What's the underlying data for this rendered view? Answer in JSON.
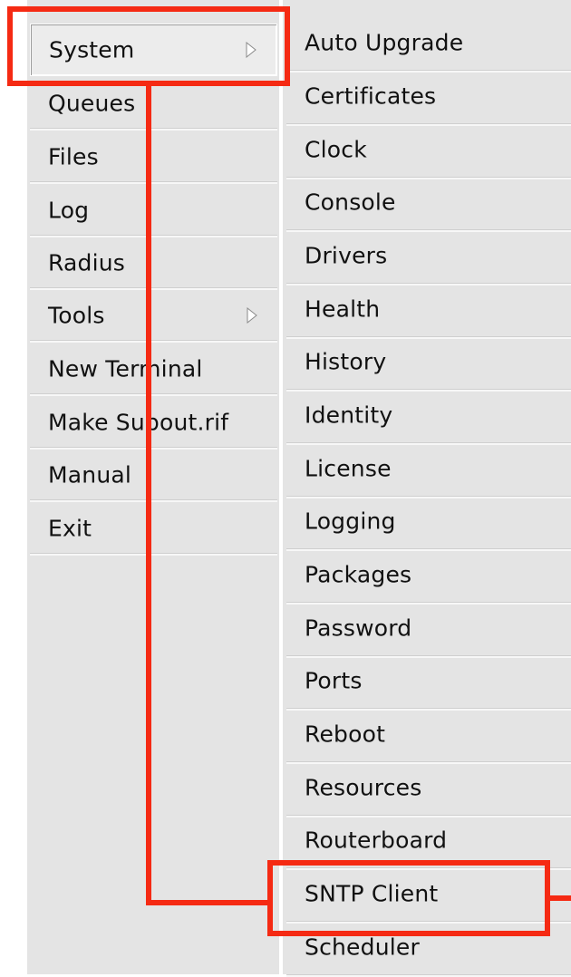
{
  "main_menu": {
    "items": [
      {
        "label": "System",
        "has_submenu": true,
        "selected": true
      },
      {
        "label": "Queues",
        "has_submenu": false
      },
      {
        "label": "Files",
        "has_submenu": false
      },
      {
        "label": "Log",
        "has_submenu": false
      },
      {
        "label": "Radius",
        "has_submenu": false
      },
      {
        "label": "Tools",
        "has_submenu": true
      },
      {
        "label": "New Terminal",
        "has_submenu": false
      },
      {
        "label": "Make Supout.rif",
        "has_submenu": false
      },
      {
        "label": "Manual",
        "has_submenu": false
      },
      {
        "label": "Exit",
        "has_submenu": false
      }
    ]
  },
  "system_submenu": {
    "items": [
      {
        "label": "Auto Upgrade"
      },
      {
        "label": "Certificates"
      },
      {
        "label": "Clock"
      },
      {
        "label": "Console"
      },
      {
        "label": "Drivers"
      },
      {
        "label": "Health"
      },
      {
        "label": "History"
      },
      {
        "label": "Identity"
      },
      {
        "label": "License"
      },
      {
        "label": "Logging"
      },
      {
        "label": "Packages"
      },
      {
        "label": "Password"
      },
      {
        "label": "Ports"
      },
      {
        "label": "Reboot"
      },
      {
        "label": "Resources"
      },
      {
        "label": "Routerboard"
      },
      {
        "label": "SNTP Client"
      },
      {
        "label": "Scheduler"
      }
    ]
  },
  "annotation": {
    "highlighted_items": [
      "System",
      "SNTP Client"
    ],
    "color": "#f52a13"
  },
  "colors": {
    "menu_background": "#e4e4e4",
    "separator_light": "#f7f7f7",
    "separator_dark": "#cfcfcf"
  }
}
